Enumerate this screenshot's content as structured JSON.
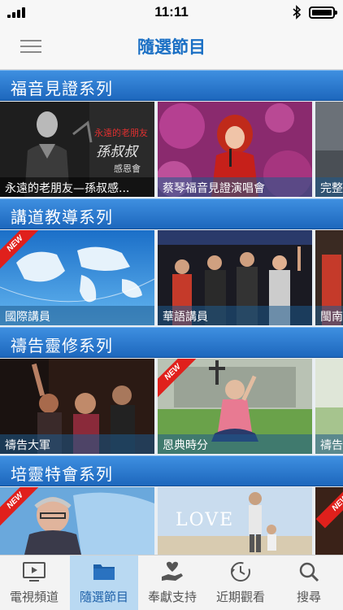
{
  "status_bar": {
    "time": "11:11"
  },
  "nav": {
    "title": "隨選節目"
  },
  "sections": [
    {
      "title": "福音見證系列",
      "cards": [
        {
          "caption": "永遠的老朋友—孫叔感...",
          "new": false
        },
        {
          "caption": "蔡琴福音見證演唱會",
          "new": false
        },
        {
          "caption": "完整",
          "new": false
        }
      ],
      "overlay_texts": [
        "永遠的老朋友",
        "孫叔叔",
        "感恩會"
      ]
    },
    {
      "title": "講道教導系列",
      "cards": [
        {
          "caption": "國際講員",
          "new": true
        },
        {
          "caption": "華語講員",
          "new": false
        },
        {
          "caption": "閩南",
          "new": false
        }
      ]
    },
    {
      "title": "禱告靈修系列",
      "cards": [
        {
          "caption": "禱告大軍",
          "new": false
        },
        {
          "caption": "恩典時分",
          "new": true
        },
        {
          "caption": "禱告",
          "new": false
        }
      ]
    },
    {
      "title": "培靈特會系列",
      "cards": [
        {
          "caption": "",
          "new": true
        },
        {
          "caption": "",
          "new": false,
          "overlay": "LOVE"
        },
        {
          "caption": "",
          "new": true
        }
      ]
    }
  ],
  "ribbon_text": "NEW",
  "tabs": [
    {
      "label": "電視頻道",
      "icon": "tv-icon",
      "active": false
    },
    {
      "label": "隨選節目",
      "icon": "folder-icon",
      "active": true
    },
    {
      "label": "奉獻支持",
      "icon": "heart-hand-icon",
      "active": false
    },
    {
      "label": "近期觀看",
      "icon": "history-icon",
      "active": false
    },
    {
      "label": "搜尋",
      "icon": "search-icon",
      "active": false
    }
  ],
  "colors": {
    "accent": "#1a6fc4",
    "header": "#2b7bd1",
    "ribbon": "#e0201c",
    "active_tab": "#b9d9f2"
  }
}
